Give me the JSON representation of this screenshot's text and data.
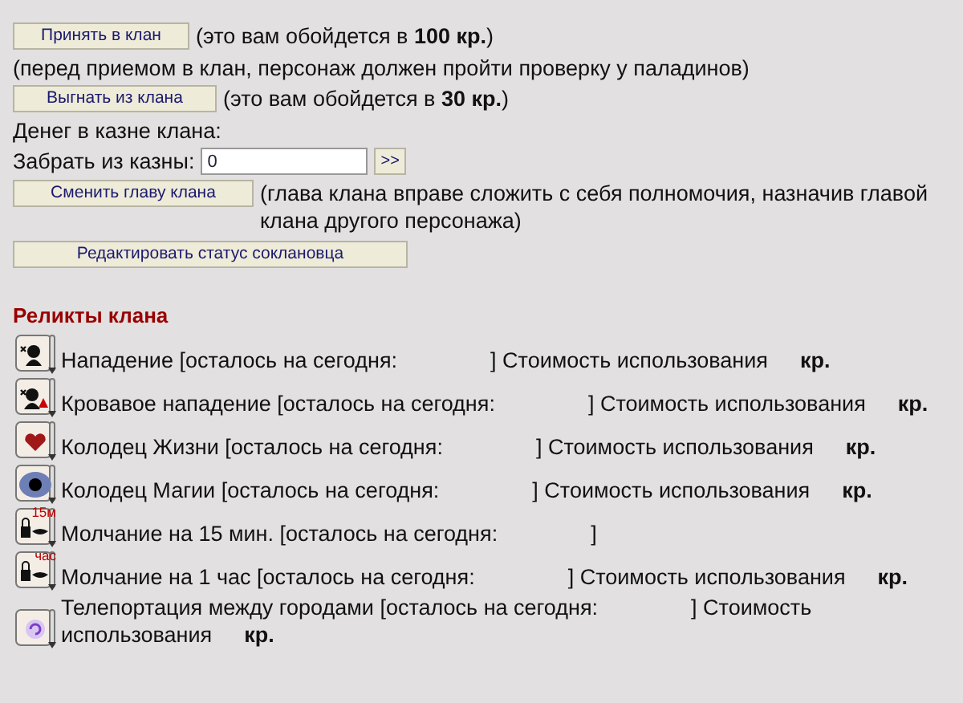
{
  "actions": [
    {
      "kind": "button-note",
      "button": "Принять в клан",
      "note": "(это вам обойдется в **100 кр.**)"
    },
    {
      "kind": "text",
      "text": "(перед приемом в клан, персонаж должен пройти проверку у паладинов)"
    },
    {
      "kind": "button-note",
      "button": "Выгнать из клана",
      "note": "(это вам обойдется в **30 кр.**)"
    },
    {
      "kind": "text",
      "text": "Денег в казне клана:"
    },
    {
      "kind": "field",
      "label": "Забрать из казны:",
      "value": "0",
      "submit": ">>"
    },
    {
      "kind": "button-note",
      "button": "Сменить главу клана",
      "note": "(глава клана вправе сложить с себя полномочия, назначив главой клана другого персонажа)"
    },
    {
      "kind": "button",
      "button": "Редактировать статус соклановца"
    }
  ],
  "relics_title": "Реликты клана",
  "relics": [
    {
      "kind": "attack",
      "name": "Нападение",
      "remaining": "[осталось на сегодня:",
      "close": "]",
      "cost": "Стоимость использования",
      "currency": "кр."
    },
    {
      "kind": "bloody-attack",
      "name": "Кровавое нападение",
      "remaining": "[осталось на сегодня:",
      "close": "]",
      "cost": "Стоимость использования",
      "currency": "кр."
    },
    {
      "kind": "heart",
      "name": "Колодец Жизни",
      "remaining": "[осталось на сегодня:",
      "close": "]",
      "cost": "Стоимость использования",
      "currency": "кр."
    },
    {
      "kind": "eye",
      "name": "Колодец Магии",
      "remaining": "[осталось на сегодня:",
      "close": "]",
      "cost": "Стоимость использования",
      "currency": "кр."
    },
    {
      "kind": "silence",
      "icon_label": "15м",
      "name": "Молчание на 15 мин.",
      "remaining": "[осталось на сегодня:",
      "close": "]"
    },
    {
      "kind": "silence",
      "icon_label": "час",
      "name": "Молчание на 1 час",
      "remaining": "[осталось на сегодня:",
      "close": "]",
      "cost": "Стоимость использования",
      "currency": "кр."
    },
    {
      "kind": "teleport",
      "name": "Телепортация между городами",
      "remaining": "[осталось на сегодня:",
      "close": "]",
      "cost": "Стоимость использования",
      "currency": "кр."
    }
  ]
}
